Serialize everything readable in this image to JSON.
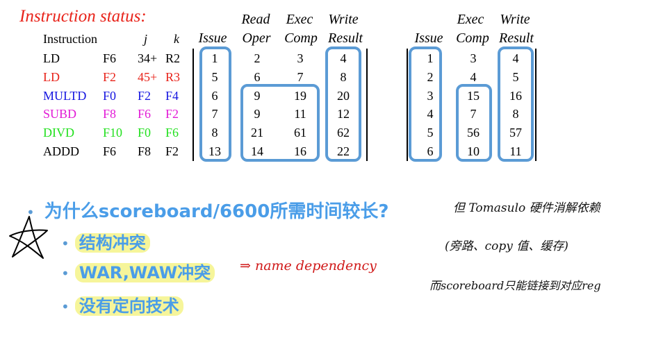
{
  "title": "Instruction status:",
  "headers_top": {
    "read": "Read",
    "exec": "Exec",
    "write": "Write",
    "exec2": "Exec",
    "write2": "Write"
  },
  "headers_bottom": {
    "instruction": "Instruction",
    "j": "j",
    "k": "k",
    "issue": "Issue",
    "oper": "Oper",
    "comp": "Comp",
    "result": "Result",
    "issue2": "Issue",
    "comp2": "Comp",
    "result2": "Result"
  },
  "instructions": [
    {
      "op": "LD",
      "dest": "F6",
      "j": "34+",
      "k": "R2",
      "color": "#000000"
    },
    {
      "op": "LD",
      "dest": "F2",
      "j": "45+",
      "k": "R3",
      "color": "#e8231a"
    },
    {
      "op": "MULTD",
      "dest": "F0",
      "j": "F2",
      "k": "F4",
      "color": "#1515e0"
    },
    {
      "op": "SUBD",
      "dest": "F8",
      "j": "F6",
      "k": "F2",
      "color": "#e21ad6"
    },
    {
      "op": "DIVD",
      "dest": "F10",
      "j": "F0",
      "k": "F6",
      "color": "#22e01e"
    },
    {
      "op": "ADDD",
      "dest": "F6",
      "j": "F8",
      "k": "F2",
      "color": "#000000"
    }
  ],
  "scoreboard": [
    {
      "issue": "1",
      "read": "2",
      "exec": "3",
      "write": "4"
    },
    {
      "issue": "5",
      "read": "6",
      "exec": "7",
      "write": "8"
    },
    {
      "issue": "6",
      "read": "9",
      "exec": "19",
      "write": "20"
    },
    {
      "issue": "7",
      "read": "9",
      "exec": "11",
      "write": "12"
    },
    {
      "issue": "8",
      "read": "21",
      "exec": "61",
      "write": "62"
    },
    {
      "issue": "13",
      "read": "14",
      "exec": "16",
      "write": "22"
    }
  ],
  "tomasulo": [
    {
      "issue": "1",
      "exec": "3",
      "write": "4"
    },
    {
      "issue": "2",
      "exec": "4",
      "write": "5"
    },
    {
      "issue": "3",
      "exec": "15",
      "write": "16"
    },
    {
      "issue": "4",
      "exec": "7",
      "write": "8"
    },
    {
      "issue": "5",
      "exec": "56",
      "write": "57"
    },
    {
      "issue": "6",
      "exec": "10",
      "write": "11"
    }
  ],
  "bullets": {
    "main": "为什么scoreboard/6600所需时间较长?",
    "sub": [
      "结构冲突",
      "WAR,WAW冲突",
      "没有定向技术"
    ]
  },
  "handwriting": {
    "name_dep": "⇒ name  dependency",
    "tomasulo_note": "但 Tomasulo 硬件消解依赖",
    "tomasulo_note2": "(旁路、copy 值、缓存)",
    "scoreboard_note": "而scoreboard只能链接到对应reg"
  },
  "colors": {
    "accent_blue": "#5b9bd5",
    "title_red": "#e8231a",
    "highlight": "#f6f59a",
    "hand_red": "#d01818"
  }
}
